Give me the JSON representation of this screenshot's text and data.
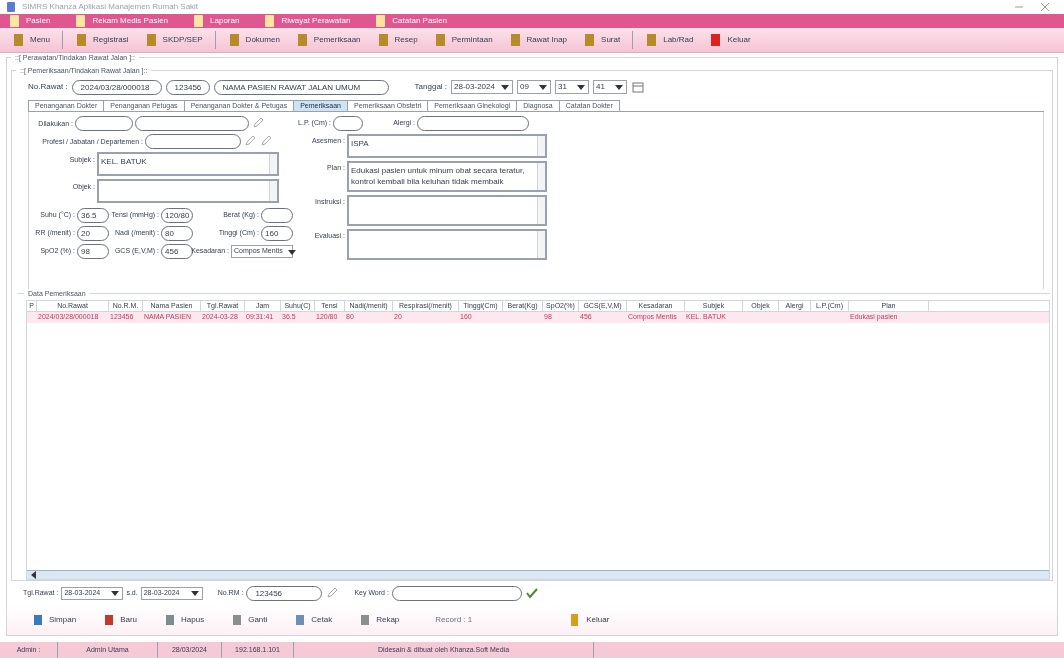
{
  "window": {
    "title": "SIMRS Khanza Aplikasi Manajemen Rumah Sakit"
  },
  "menu": [
    {
      "label": "Pasien"
    },
    {
      "label": "Rekam Medis Pasien"
    },
    {
      "label": "Laporan"
    },
    {
      "label": "Riwayat Perawatan"
    },
    {
      "label": "Catatan Pasien"
    }
  ],
  "toolbar": [
    {
      "label": "Menu",
      "sep_after": true
    },
    {
      "label": "Registrasi"
    },
    {
      "label": "SKDP/SEP",
      "sep_after": true
    },
    {
      "label": "Dokumen"
    },
    {
      "label": "Pemeriksaan"
    },
    {
      "label": "Resep"
    },
    {
      "label": "Permintaan"
    },
    {
      "label": "Rawat Inap"
    },
    {
      "label": "Surat",
      "sep_after": true
    },
    {
      "label": "Lab/Rad"
    },
    {
      "label": "Keluar"
    }
  ],
  "frame_title": "::[ Perawatan/Tindakan Rawat Jalan ]::",
  "inner_title": "::[ Pemeriksaan/Tindakan Rawat Jalan ]::",
  "visit": {
    "label": "No.Rawat :",
    "no_rawat": "2024/03/28/000018",
    "no_rm": "123456",
    "patient": "NAMA PASIEN RAWAT JALAN UMUM",
    "date_label": "Tanggal :",
    "date": "28-03-2024",
    "hour": "09",
    "minute": "31",
    "second": "41"
  },
  "tabs": [
    {
      "label": "Penanganan Dokter",
      "selected": false
    },
    {
      "label": "Penanganan Petugas",
      "selected": false
    },
    {
      "label": "Penanganan Dokter & Petugas",
      "selected": false
    },
    {
      "label": "Pemeriksaan",
      "selected": true
    },
    {
      "label": "Pemeriksaan Obstetri",
      "selected": false
    },
    {
      "label": "Pemeriksaan Ginekologi",
      "selected": false
    },
    {
      "label": "Diagnosa",
      "selected": false
    },
    {
      "label": "Catatan Dokter",
      "selected": false
    }
  ],
  "exam": {
    "dilakukan": {
      "label": "Dilakukan :"
    },
    "profesi": {
      "label": "Profesi / Jabatan / Departemen :"
    },
    "subjek": {
      "label": "Subjek :",
      "value": "KEL. BATUK"
    },
    "objek": {
      "label": "Objek :"
    },
    "vitals": [
      {
        "label": "Suhu (°C) :",
        "value": "36.5",
        "kind": "input"
      },
      {
        "label": "Tensi (mmHg) :",
        "value": "120/80",
        "kind": "input"
      },
      {
        "label": "Berat (Kg) :",
        "kind": "input"
      },
      {
        "label": "RR (/menit) :",
        "value": "20",
        "kind": "input"
      },
      {
        "label": "Nadi (/menit) :",
        "value": "80",
        "kind": "input"
      },
      {
        "label": "Tinggi (Cm) :",
        "value": "160",
        "kind": "input"
      },
      {
        "label": "SpO2 (%) :",
        "value": "98",
        "kind": "input"
      },
      {
        "label": "GCS (E,V,M) :",
        "value": "456",
        "kind": "input"
      },
      {
        "label": "Kesadaran :",
        "value": "Compos Mentis",
        "kind": "select"
      }
    ],
    "lp": {
      "label": "L.P. (Cm) :"
    },
    "alergi": {
      "label": "Alergi :"
    },
    "right": [
      {
        "label": "Asesmen :",
        "value": "ISPA"
      },
      {
        "label": "Plan :",
        "value": "Edukasi pasien untuk minum obat secara teratur, kontrol kembali bila keluhan tidak membaik"
      },
      {
        "label": "Instruksi :"
      },
      {
        "label": "Evaluasi :"
      }
    ]
  },
  "table": {
    "title": "Data Pemeriksaan",
    "columns": [
      "P",
      "No.Rawat",
      "No.R.M.",
      "Nama Pasien",
      "Tgl.Rawat",
      "Jam",
      "Suhu(C)",
      "Tensi",
      "Nadi(/menit)",
      "Respirasi(/menit)",
      "Tinggi(Cm)",
      "Berat(Kg)",
      "SpO2(%)",
      "GCS(E,V,M)",
      "Kesadaran",
      "Subjek",
      "Objek",
      "Alergi",
      "L.P.(Cm)",
      "Plan"
    ],
    "rows": [
      {
        "cells": [
          "",
          "2024/03/28/000018",
          "123456",
          "NAMA PASIEN",
          "2024-03-28",
          "09:31:41",
          "36.5",
          "120/80",
          "80",
          "20",
          "160",
          "",
          "98",
          "456",
          "Compos Mentis",
          "KEL. BATUK",
          "",
          "",
          "",
          "Edukasi pasien"
        ],
        "selected": true
      }
    ]
  },
  "filter": {
    "date_label": "Tgl.Rawat :",
    "from": "28-03-2024",
    "to_label": "s.d.",
    "to": "28-03-2024",
    "rm_label": "No.RM :",
    "rm": "123456",
    "key_label": "Key Word :"
  },
  "buttons": [
    {
      "label": "Simpan"
    },
    {
      "label": "Baru"
    },
    {
      "label": "Hapus"
    },
    {
      "label": "Ganti"
    },
    {
      "label": "Cetak"
    },
    {
      "label": "Rekap"
    }
  ],
  "record": "Record : 1",
  "exit": "Keluar",
  "status_bar": [
    "Admin :",
    "Admin Utama",
    "28/03/2024",
    "192.168.1.101",
    "Didesain & dibuat oleh Khanza.Soft Media"
  ]
}
